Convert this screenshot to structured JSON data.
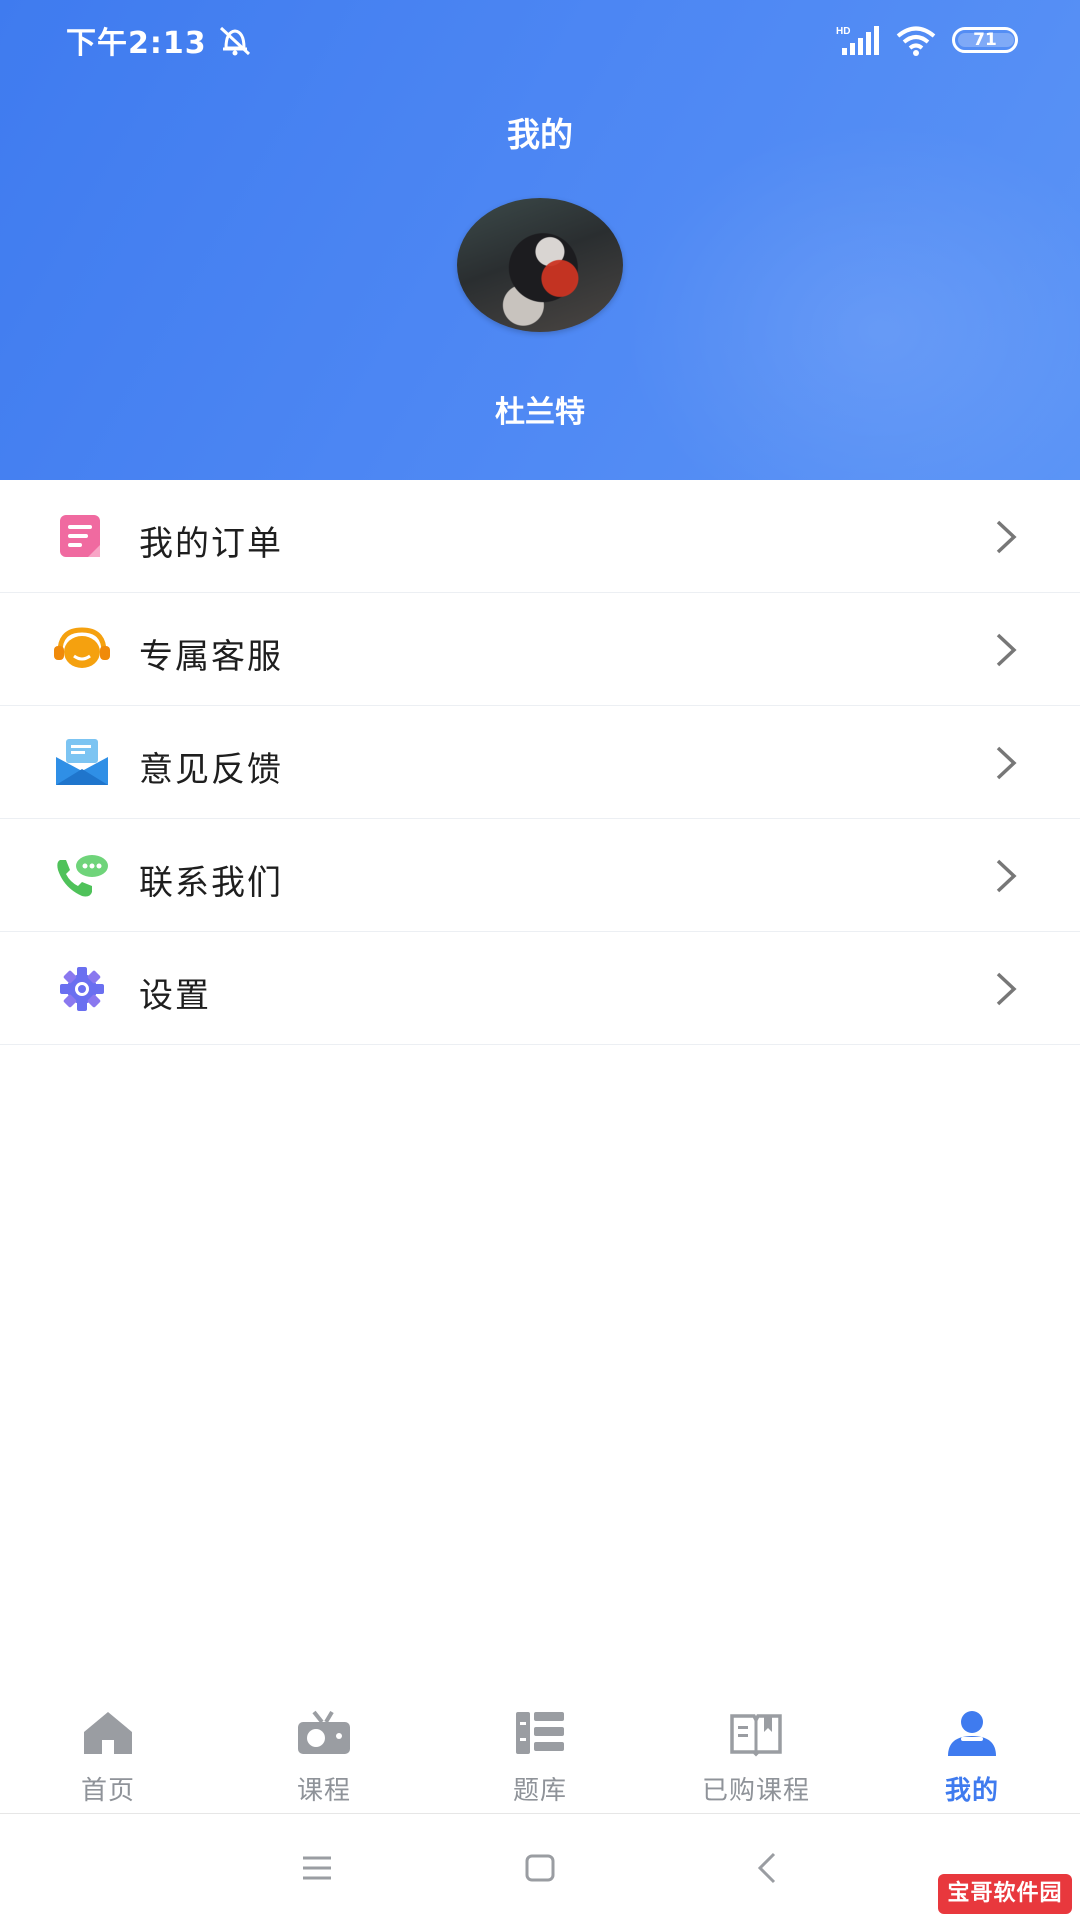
{
  "status_bar": {
    "time": "下午2:13",
    "battery": "71",
    "network_badge": "HD"
  },
  "header": {
    "title": "我的",
    "username": "杜兰特"
  },
  "menu": {
    "items": [
      {
        "label": "我的订单",
        "icon": "order-icon",
        "color": "#f06aa0"
      },
      {
        "label": "专属客服",
        "icon": "headset-icon",
        "color": "#f5a10f"
      },
      {
        "label": "意见反馈",
        "icon": "feedback-envelope-icon",
        "color": "#2f8fe6"
      },
      {
        "label": "联系我们",
        "icon": "phone-icon",
        "color": "#4fc25a"
      },
      {
        "label": "设置",
        "icon": "gear-icon",
        "color": "#6a6ff0"
      }
    ]
  },
  "tabbar": {
    "tabs": [
      {
        "label": "首页",
        "icon": "home-icon",
        "active": false
      },
      {
        "label": "课程",
        "icon": "tv-icon",
        "active": false
      },
      {
        "label": "题库",
        "icon": "question-bank-icon",
        "active": false
      },
      {
        "label": "已购课程",
        "icon": "book-icon",
        "active": false
      },
      {
        "label": "我的",
        "icon": "user-icon",
        "active": true
      }
    ]
  },
  "watermark": "宝哥软件园",
  "colors": {
    "accent": "#3f7bef",
    "tab_inactive": "#8f9399"
  }
}
